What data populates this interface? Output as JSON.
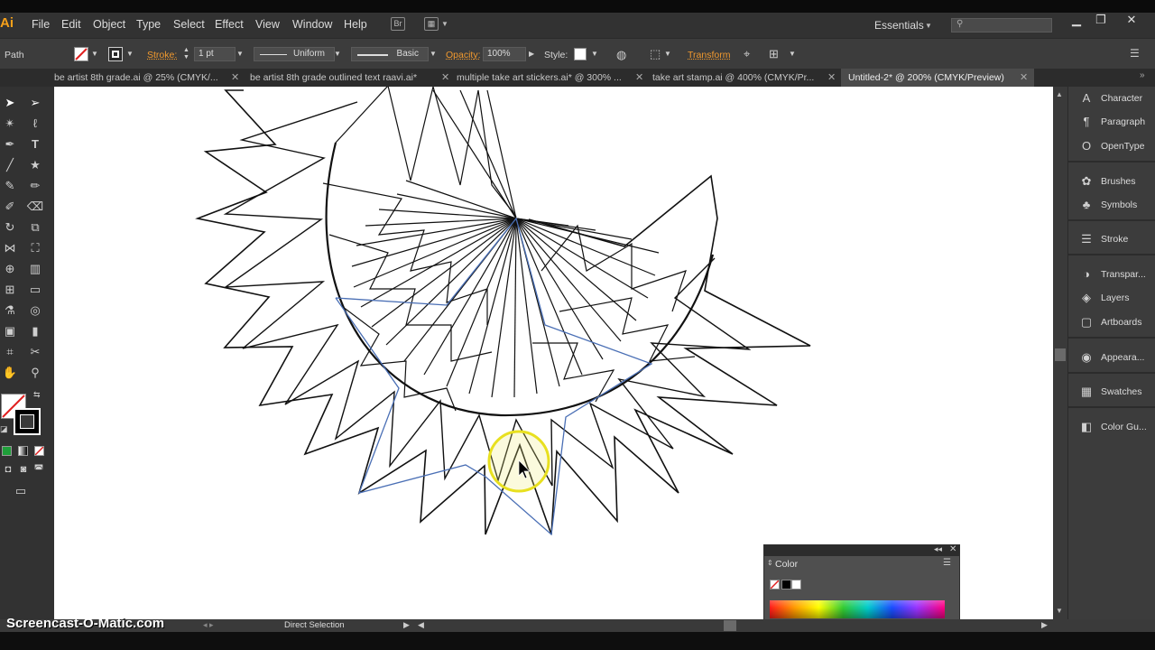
{
  "app": {
    "logo": "Ai",
    "menus": [
      "File",
      "Edit",
      "Object",
      "Type",
      "Select",
      "Effect",
      "View",
      "Window",
      "Help"
    ],
    "bridge_icon": "Br",
    "workspace": "Essentials",
    "window_controls": [
      "minimize-icon",
      "restore-icon",
      "close-icon"
    ]
  },
  "control": {
    "selection_type": "Path",
    "stroke_label": "Stroke:",
    "stroke_weight": "1 pt",
    "profile": "Uniform",
    "brush": "Basic",
    "opacity_label": "Opacity:",
    "opacity_value": "100%",
    "style_label": "Style:",
    "transform_label": "Transform"
  },
  "tabs": [
    {
      "label": "be artist 8th grade.ai @ 25% (CMYK/...",
      "active": false
    },
    {
      "label": "be artist 8th grade outlined text raavi.ai*",
      "active": false
    },
    {
      "label": "multiple take art stickers.ai* @ 300% ...",
      "active": false
    },
    {
      "label": "take art stamp.ai @ 400% (CMYK/Pr...",
      "active": false
    },
    {
      "label": "Untitled-2* @ 200% (CMYK/Preview)",
      "active": true
    }
  ],
  "tools": [
    "selection-tool",
    "direct-selection-tool",
    "magic-wand-tool",
    "lasso-tool",
    "pen-tool",
    "type-tool",
    "line-tool",
    "star-tool",
    "paintbrush-tool",
    "pencil-tool",
    "blob-brush-tool",
    "eraser-tool",
    "rotate-tool",
    "scale-tool",
    "width-tool",
    "free-transform-tool",
    "shape-builder-tool",
    "perspective-grid-tool",
    "mesh-tool",
    "gradient-tool",
    "eyedropper-tool",
    "blend-tool",
    "symbol-sprayer-tool",
    "column-graph-tool",
    "artboard-tool",
    "slice-tool",
    "hand-tool",
    "zoom-tool"
  ],
  "panels": [
    {
      "label": "Character",
      "icon": "character-icon"
    },
    {
      "label": "Paragraph",
      "icon": "paragraph-icon"
    },
    {
      "label": "OpenType",
      "icon": "opentype-icon"
    },
    {
      "label": "Brushes",
      "icon": "brushes-icon"
    },
    {
      "label": "Symbols",
      "icon": "symbols-icon"
    },
    {
      "label": "Stroke",
      "icon": "stroke-icon"
    },
    {
      "label": "Transpar...",
      "icon": "transparency-icon"
    },
    {
      "label": "Layers",
      "icon": "layers-icon"
    },
    {
      "label": "Artboards",
      "icon": "artboards-icon"
    },
    {
      "label": "Appeara...",
      "icon": "appearance-icon"
    },
    {
      "label": "Swatches",
      "icon": "swatches-icon"
    },
    {
      "label": "Color Gu...",
      "icon": "color-guide-icon"
    }
  ],
  "color_panel": {
    "title": "Color"
  },
  "status": {
    "current_tool": "Direct Selection",
    "watermark": "Screencast-O-Matic.com"
  },
  "colors": {
    "accent_orange": "#f29a2e",
    "selection_blue": "#4a6fb5",
    "cursor_highlight": "#e8e020"
  }
}
